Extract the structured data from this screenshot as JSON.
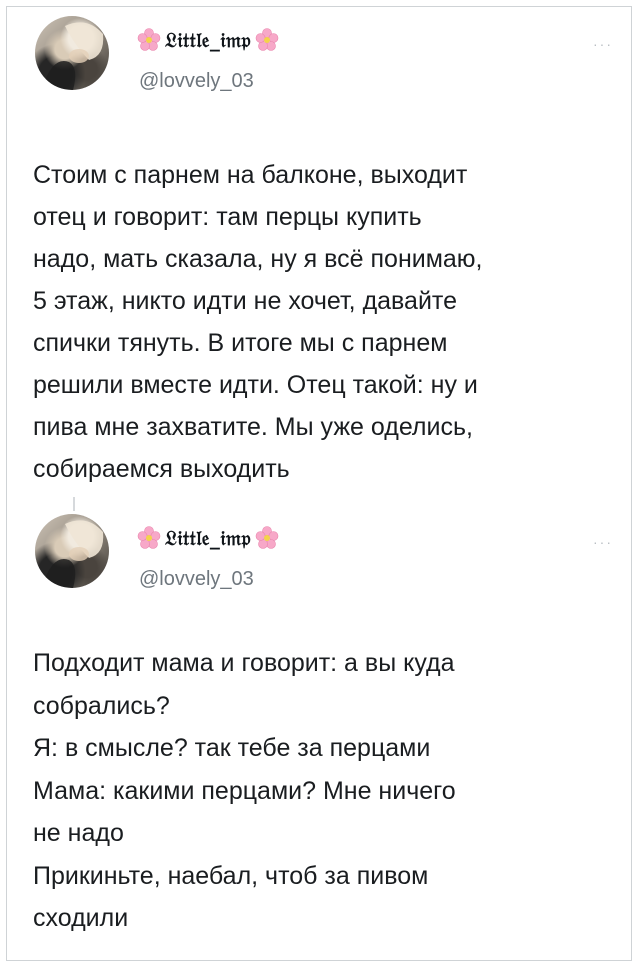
{
  "tweets": [
    {
      "display_name": "𝔏𝔦𝔱𝔱𝔩𝔢_𝔦𝔪𝔭",
      "handle": "@lovvely_03",
      "more": "···",
      "text": "Стоим с парнем на балконе, выходит\nотец и говорит: там перцы купить\nнадо, мать сказала, ну я всё понимаю,\n5 этаж, никто идти не хочет, давайте\nспички тянуть. В итоге мы с парнем\nрешили вместе идти. Отец такой: ну и\nпива мне захватите. Мы уже оделись,\nсобираемся выходить"
    },
    {
      "display_name": "𝔏𝔦𝔱𝔱𝔩𝔢_𝔦𝔪𝔭",
      "handle": "@lovvely_03",
      "more": "···",
      "text": "Подходит мама и говорит: а вы куда\nсобрались?\nЯ: в смысле? так тебе за перцами\nМама: какими перцами? Мне ничего\nне надо\nПрикиньте, наебал, чтоб за пивом\nсходили"
    }
  ],
  "icons": {
    "flower": "cherry-blossom-icon",
    "more": "more-options-icon"
  },
  "colors": {
    "flower_petal": "#f7a8c8",
    "flower_center": "#f3d34a",
    "handle": "#6e767d",
    "text": "#0f1419"
  }
}
